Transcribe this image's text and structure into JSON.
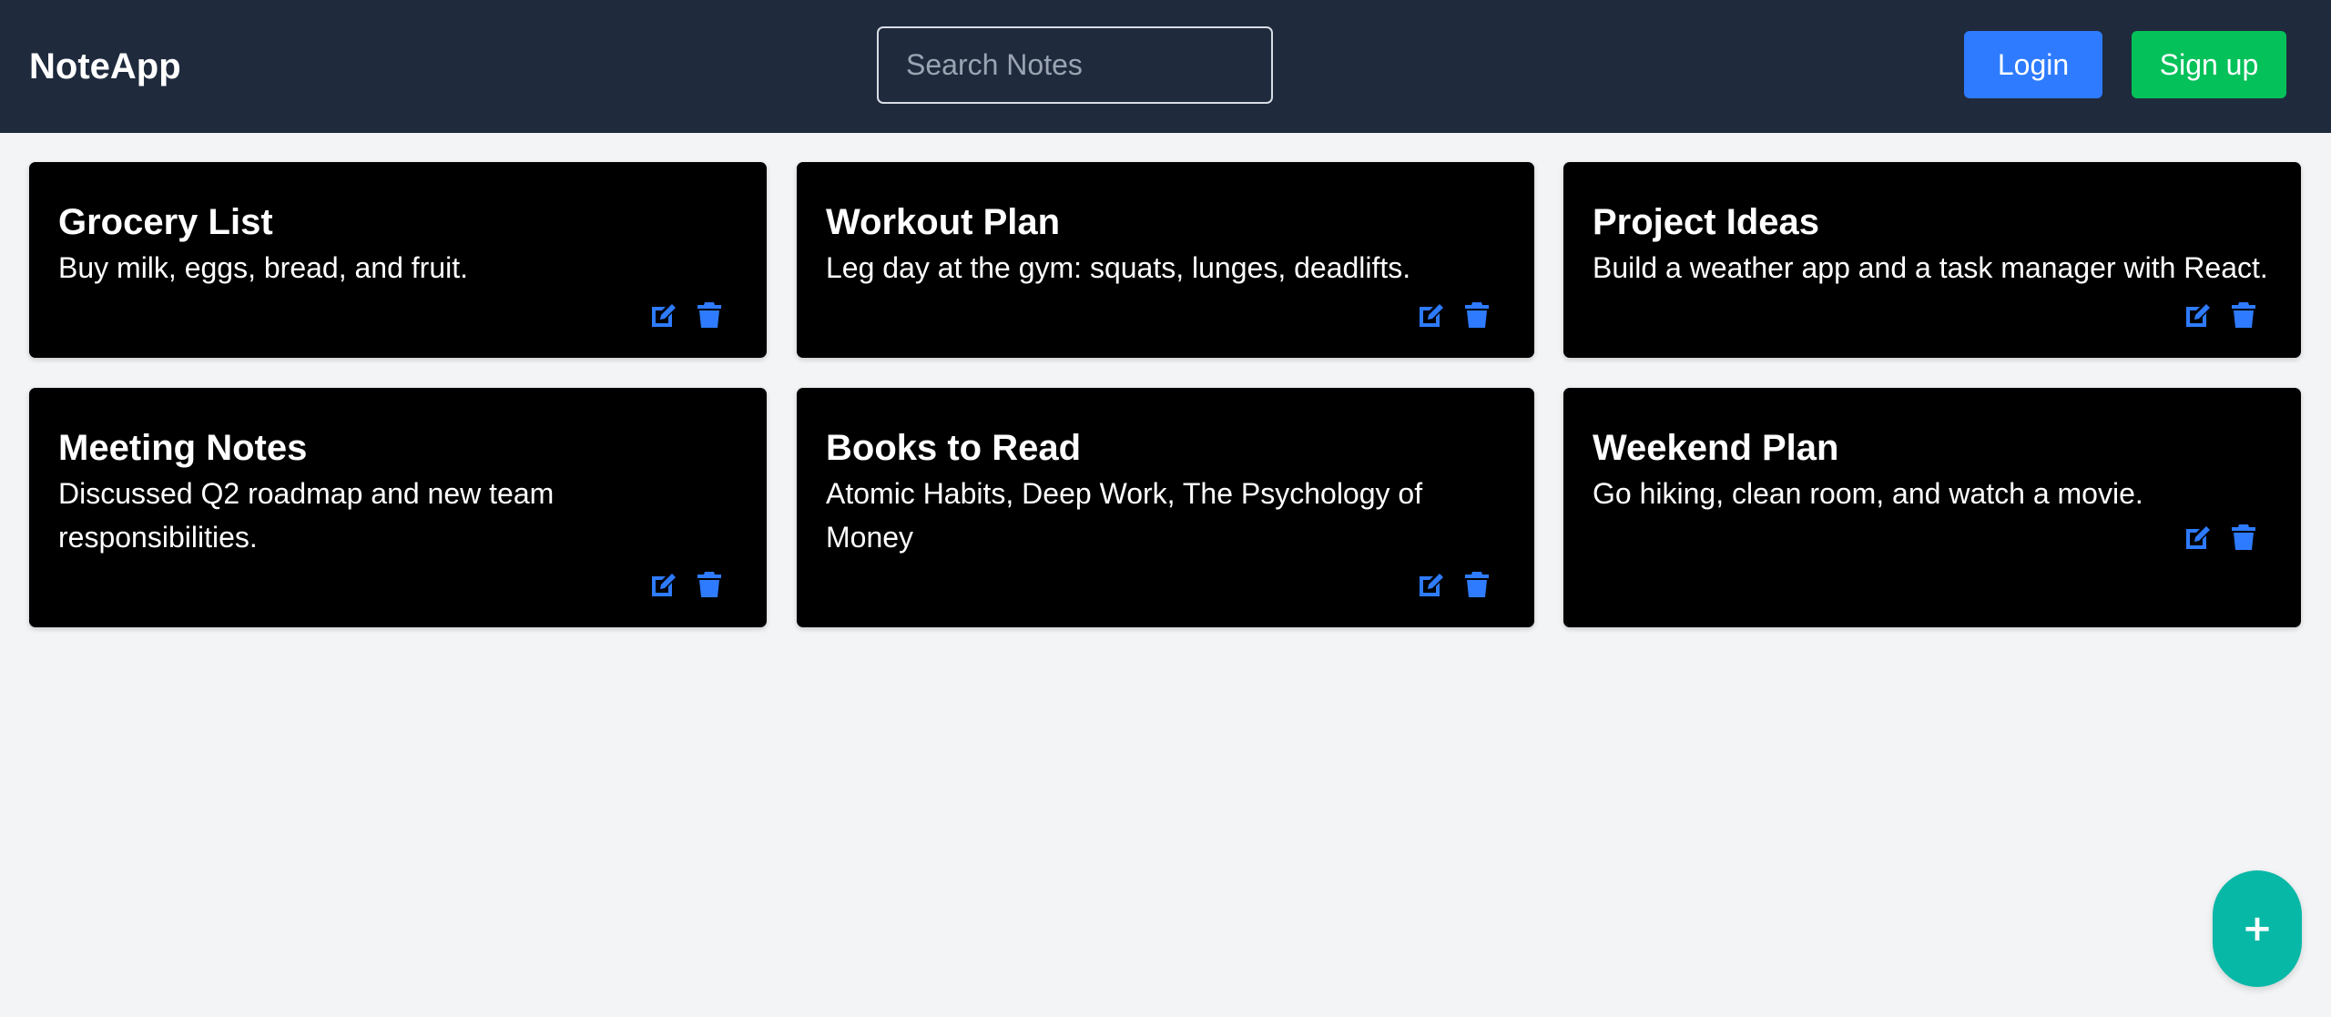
{
  "header": {
    "brand": "NoteApp",
    "search_placeholder": "Search Notes",
    "login_label": "Login",
    "signup_label": "Sign up"
  },
  "notes": [
    {
      "title": "Grocery List",
      "body": "Buy milk, eggs, bread, and fruit."
    },
    {
      "title": "Workout Plan",
      "body": "Leg day at the gym: squats, lunges, deadlifts."
    },
    {
      "title": "Project Ideas",
      "body": "Build a weather app and a task manager with React."
    },
    {
      "title": "Meeting Notes",
      "body": "Discussed Q2 roadmap and new team responsibilities."
    },
    {
      "title": "Books to Read",
      "body": "Atomic Habits, Deep Work, The Psychology of Money"
    },
    {
      "title": "Weekend Plan",
      "body": "Go hiking, clean room, and watch a movie."
    }
  ],
  "icons": {
    "edit": "edit-icon",
    "delete": "trash-icon",
    "add": "plus-icon"
  },
  "fab": {
    "label": "+"
  },
  "colors": {
    "header_bg": "#1f2a3d",
    "login": "#2e7bff",
    "signup": "#05c15a",
    "card_bg": "#000000",
    "icon_blue": "#2e7bff",
    "fab": "#08b8a7",
    "page_bg": "#f2f4f6"
  }
}
